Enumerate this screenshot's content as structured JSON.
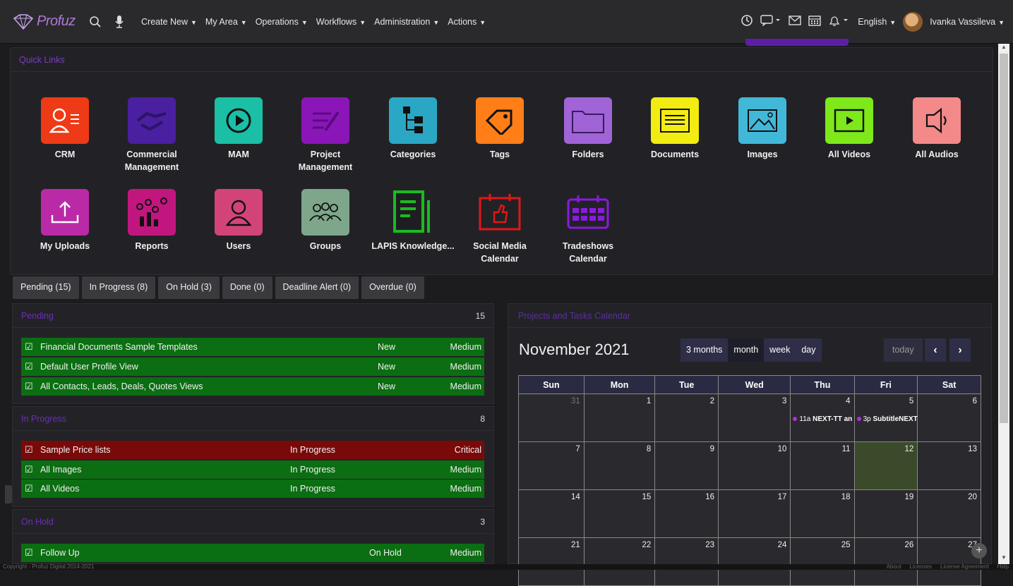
{
  "nav": {
    "logo_text": "Profuz",
    "menu": [
      {
        "label": "Create New"
      },
      {
        "label": "My Area"
      },
      {
        "label": "Operations"
      },
      {
        "label": "Workflows"
      },
      {
        "label": "Administration"
      },
      {
        "label": "Actions"
      }
    ],
    "language": "English",
    "user_name": "Ivanka Vassileva"
  },
  "quick_links": {
    "title": "Quick Links",
    "tiles": [
      {
        "label": "CRM",
        "color": "#ee3a16",
        "icon": "crm-icon"
      },
      {
        "label": "Commercial Management",
        "color": "#4a1fa0",
        "icon": "handshake-icon"
      },
      {
        "label": "MAM",
        "color": "#1abfa6",
        "icon": "play-circle-icon"
      },
      {
        "label": "Project Management",
        "color": "#8b16b8",
        "icon": "project-icon"
      },
      {
        "label": "Categories",
        "color": "#2aa7c4",
        "icon": "categories-icon"
      },
      {
        "label": "Tags",
        "color": "#ff7e18",
        "icon": "tag-icon"
      },
      {
        "label": "Folders",
        "color": "#a064d6",
        "icon": "folder-icon"
      },
      {
        "label": "Documents",
        "color": "#f2ec12",
        "icon": "document-icon"
      },
      {
        "label": "Images",
        "color": "#42b8d9",
        "icon": "image-icon"
      },
      {
        "label": "All Videos",
        "color": "#7ee81a",
        "icon": "video-icon"
      },
      {
        "label": "All Audios",
        "color": "#f4898a",
        "icon": "speaker-icon"
      },
      {
        "label": "My Uploads",
        "color": "#bb2aa6",
        "icon": "upload-icon"
      },
      {
        "label": "Reports",
        "color": "#c2167f",
        "icon": "reports-icon"
      },
      {
        "label": "Users",
        "color": "#d24479",
        "icon": "user-icon"
      },
      {
        "label": "Groups",
        "color": "#7ea68b",
        "icon": "groups-icon"
      },
      {
        "label": "LAPIS Knowledge...",
        "color": "#1abb20",
        "icon": "knowledge-icon"
      },
      {
        "label": "Social Media Calendar",
        "color": "#e01818",
        "icon": "social-calendar-icon"
      },
      {
        "label": "Tradeshows Calendar",
        "color": "#8a1ae0",
        "icon": "tradeshow-calendar-icon"
      }
    ]
  },
  "status_tabs": [
    {
      "label": "Pending (15)"
    },
    {
      "label": "In Progress (8)"
    },
    {
      "label": "On Hold (3)"
    },
    {
      "label": "Done (0)"
    },
    {
      "label": "Deadline Alert (0)"
    },
    {
      "label": "Overdue (0)"
    }
  ],
  "panels": {
    "pending": {
      "title": "Pending",
      "count": "15",
      "tasks": [
        {
          "name": "Financial Documents Sample Templates",
          "status": "New",
          "priority": "Medium"
        },
        {
          "name": "Default User Profile View",
          "status": "New",
          "priority": "Medium"
        },
        {
          "name": "All Contacts, Leads, Deals, Quotes Views",
          "status": "New",
          "priority": "Medium"
        }
      ]
    },
    "in_progress": {
      "title": "In Progress",
      "count": "8",
      "tasks": [
        {
          "name": "Sample Price lists",
          "status": "In Progress",
          "priority": "Critical"
        },
        {
          "name": "All Images",
          "status": "In Progress",
          "priority": "Medium"
        },
        {
          "name": "All Videos",
          "status": "In Progress",
          "priority": "Medium"
        }
      ]
    },
    "on_hold": {
      "title": "On Hold",
      "count": "3",
      "tasks": [
        {
          "name": "Follow Up",
          "status": "On Hold",
          "priority": "Medium"
        }
      ]
    }
  },
  "calendar": {
    "panel_title": "Projects and Tasks Calendar",
    "month_title": "November 2021",
    "views": [
      "3 months",
      "month",
      "week",
      "day"
    ],
    "today_label": "today",
    "prev": "‹",
    "next": "›",
    "weekdays": [
      "Sun",
      "Mon",
      "Tue",
      "Wed",
      "Thu",
      "Fri",
      "Sat"
    ],
    "weeks": [
      [
        "31",
        "1",
        "2",
        "3",
        "4",
        "5",
        "6"
      ],
      [
        "7",
        "8",
        "9",
        "10",
        "11",
        "12",
        "13"
      ],
      [
        "14",
        "15",
        "16",
        "17",
        "18",
        "19",
        "20"
      ],
      [
        "21",
        "22",
        "23",
        "24",
        "25",
        "26",
        "27"
      ]
    ],
    "events": [
      {
        "time": "11a",
        "title": "NEXT-TT an"
      },
      {
        "time": "3p",
        "title": "SubtitleNEXT"
      }
    ]
  },
  "footer": {
    "copyright": "Copyright - Profuz Digital 2014-2021",
    "links": [
      "About",
      "Licenses",
      "License Agreement",
      "Help"
    ]
  }
}
